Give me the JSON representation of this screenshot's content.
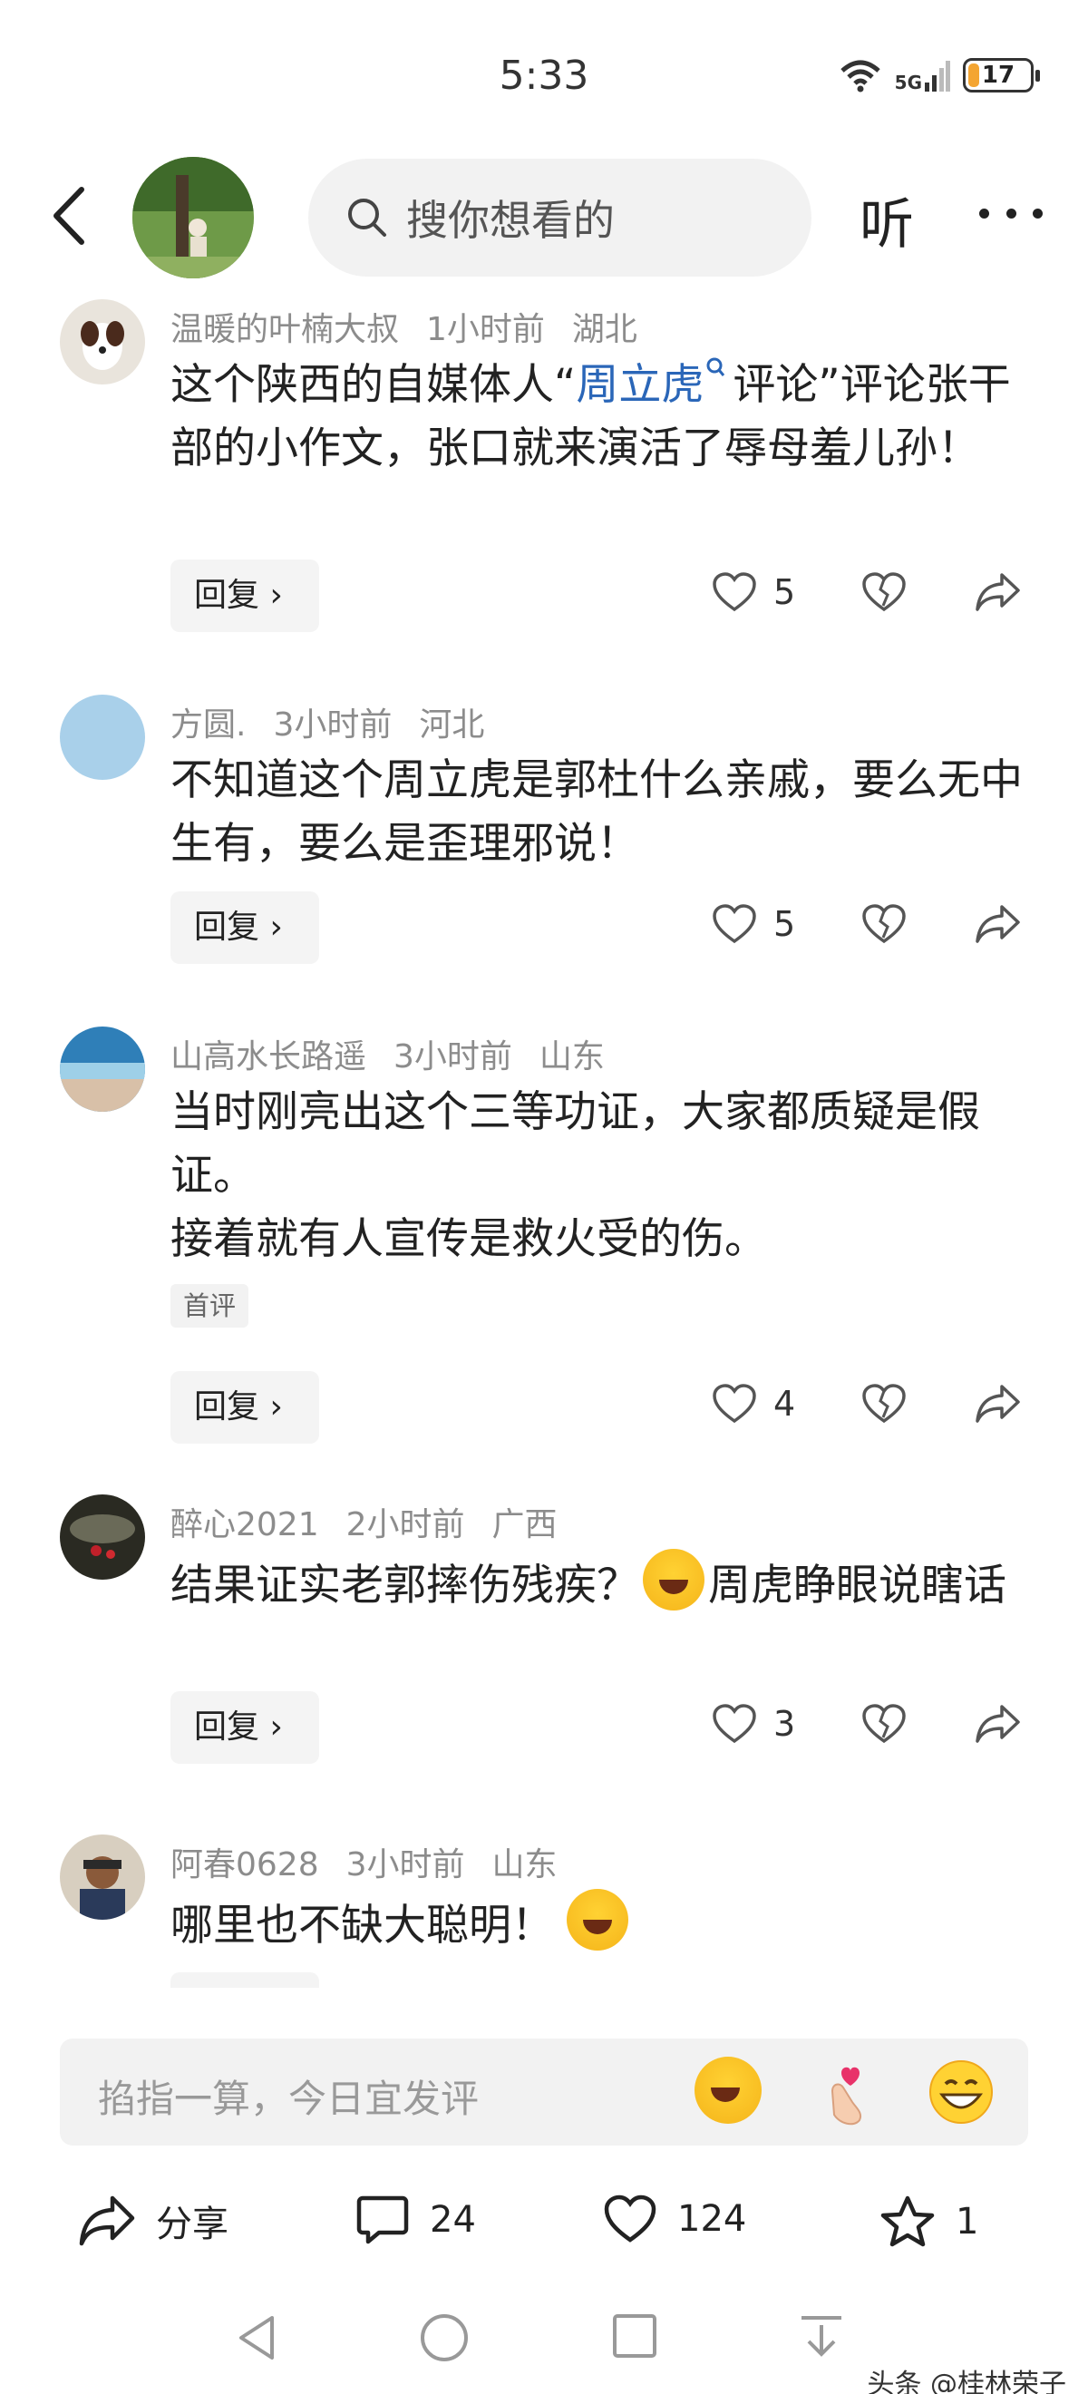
{
  "status_bar": {
    "time": "5:33",
    "network": "5G",
    "battery": "17",
    "battery_level": 0.17
  },
  "header": {
    "search_placeholder": "搜你想看的",
    "listen_label": "听"
  },
  "comments": [
    {
      "user": "温暖的叶楠大叔",
      "time": "1小时前",
      "location": "湖北",
      "text_before_link": "这个陕西的自媒体人“",
      "link_text": "周立虎",
      "text_after_link": "评论”评论张干部的小作文，张口就来演活了辱母羞儿孙！",
      "reply_label": "回复 ›",
      "likes": "5"
    },
    {
      "user": "方圆.",
      "time": "3小时前",
      "location": "河北",
      "text": "不知道这个周立虎是郭杜什么亲戚，要么无中生有，要么是歪理邪说！",
      "reply_label": "回复 ›",
      "likes": "5"
    },
    {
      "user": "山高水长路遥",
      "time": "3小时前",
      "location": "山东",
      "text_line1": "当时刚亮出这个三等功证，大家都质疑是假证。",
      "text_line2": "接着就有人宣传是救火受的伤。",
      "tag": "首评",
      "reply_label": "回复 ›",
      "likes": "4"
    },
    {
      "user": "醉心2021",
      "time": "2小时前",
      "location": "广西",
      "text_before_emoji": "结果证实老郭摔伤残疾？",
      "text_after_emoji": "周虎睁眼说瞎话",
      "reply_label": "回复 ›",
      "likes": "3"
    },
    {
      "user": "阿春0628",
      "time": "3小时前",
      "location": "山东",
      "text": "哪里也不缺大聪明！"
    }
  ],
  "input": {
    "placeholder": "掐指一算，今日宜发评"
  },
  "bottom_bar": {
    "share_label": "分享",
    "comments_count": "24",
    "likes_count": "124",
    "favorites_count": "1"
  },
  "watermark": "头条 @桂林荣子",
  "icons": [
    "back-arrow-icon",
    "search-icon",
    "more-icon",
    "heart-icon",
    "broken-heart-icon",
    "share-icon",
    "comment-icon",
    "star-icon",
    "laugh-cry-emoji",
    "finger-heart-emoji",
    "grin-emoji"
  ]
}
